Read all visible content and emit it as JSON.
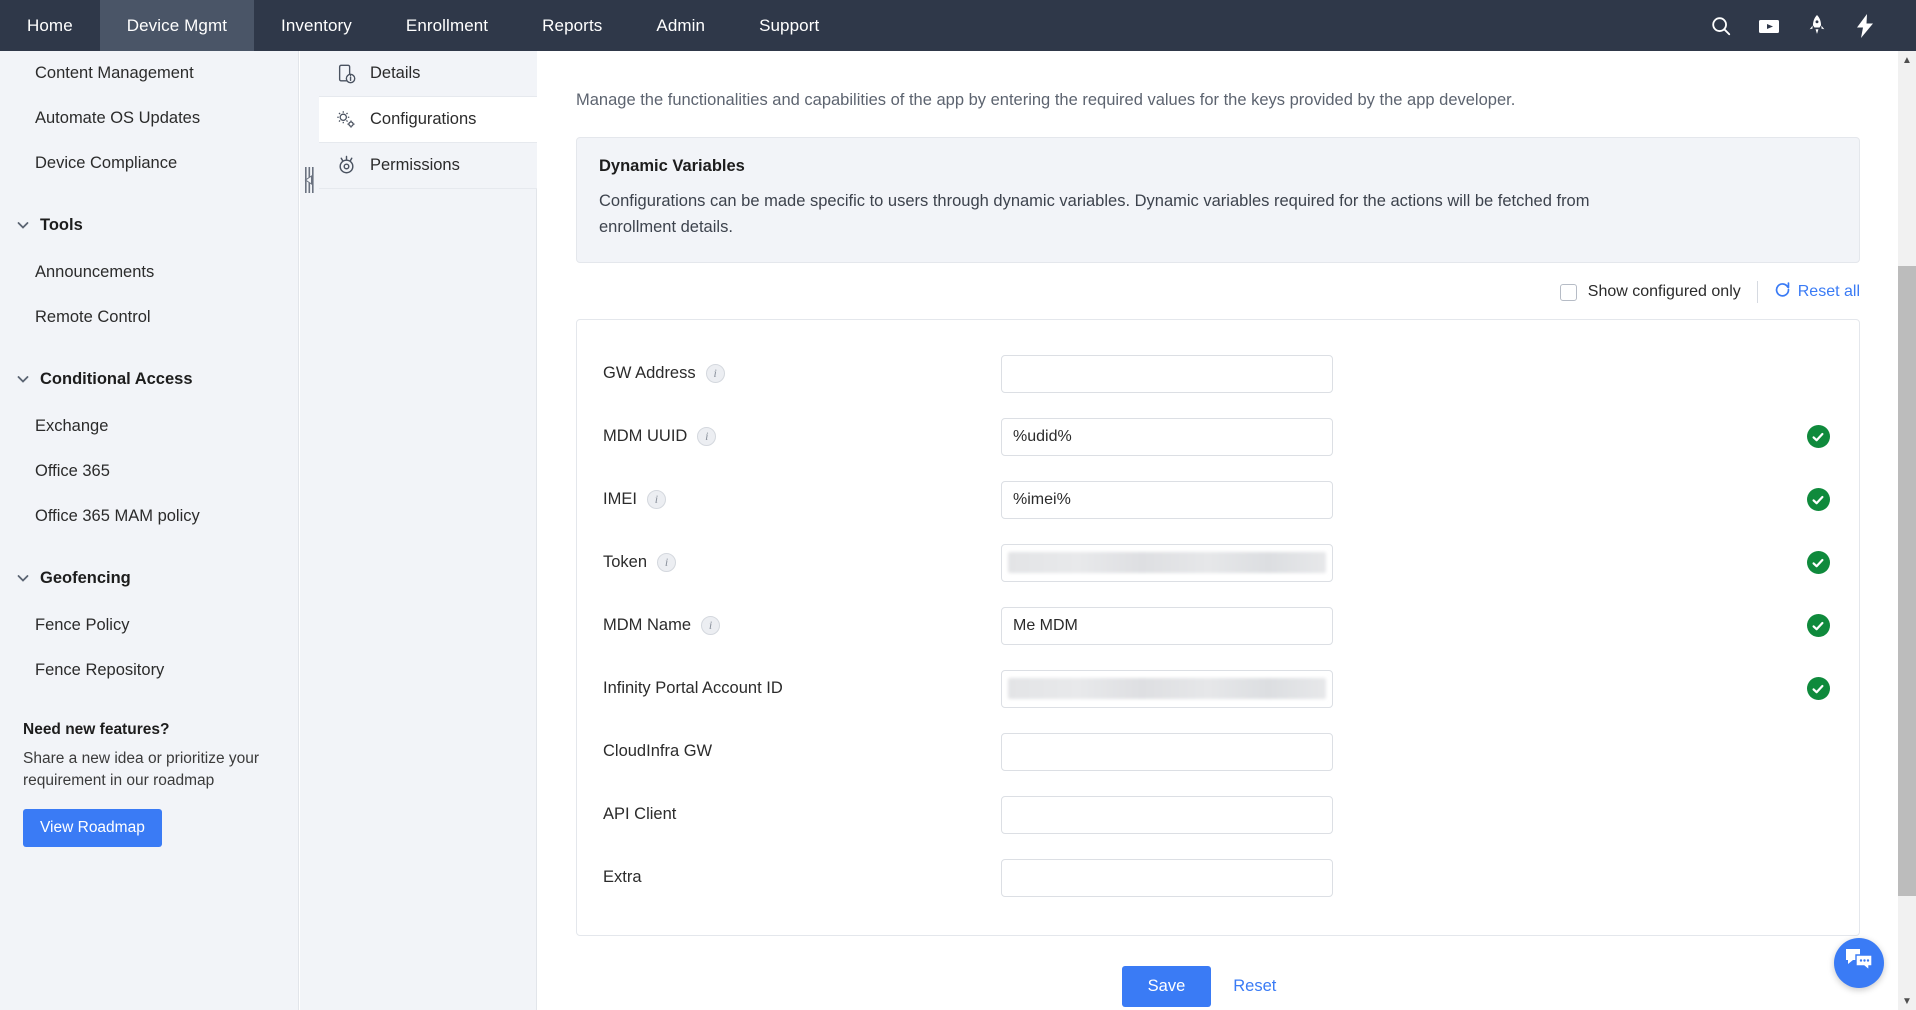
{
  "topnav": {
    "items": [
      {
        "label": "Home",
        "active": false
      },
      {
        "label": "Device Mgmt",
        "active": true
      },
      {
        "label": "Inventory",
        "active": false
      },
      {
        "label": "Enrollment",
        "active": false
      },
      {
        "label": "Reports",
        "active": false
      },
      {
        "label": "Admin",
        "active": false
      },
      {
        "label": "Support",
        "active": false
      }
    ],
    "icons": [
      "search-icon",
      "video-icon",
      "rocket-icon",
      "lightning-icon"
    ]
  },
  "sidebar": {
    "links_top": [
      {
        "label": "Content Management"
      },
      {
        "label": "Automate OS Updates"
      },
      {
        "label": "Device Compliance"
      }
    ],
    "groups": [
      {
        "label": "Tools",
        "items": [
          {
            "label": "Announcements"
          },
          {
            "label": "Remote Control"
          }
        ]
      },
      {
        "label": "Conditional Access",
        "items": [
          {
            "label": "Exchange"
          },
          {
            "label": "Office 365"
          },
          {
            "label": "Office 365 MAM policy"
          }
        ]
      },
      {
        "label": "Geofencing",
        "items": [
          {
            "label": "Fence Policy"
          },
          {
            "label": "Fence Repository"
          }
        ]
      }
    ],
    "promo": {
      "title": "Need new features?",
      "text": "Share a new idea or prioritize your requirement in our roadmap",
      "button": "View Roadmap"
    }
  },
  "subnav": {
    "items": [
      {
        "label": "Details",
        "icon": "device-info-icon",
        "active": false
      },
      {
        "label": "Configurations",
        "icon": "gears-icon",
        "active": true
      },
      {
        "label": "Permissions",
        "icon": "permissions-target-icon",
        "active": false
      }
    ]
  },
  "main": {
    "lead": "Manage the functionalities and capabilities of the app by entering the required values for the keys provided by the app developer.",
    "infobox": {
      "title": "Dynamic Variables",
      "body": "Configurations can be made specific to users through dynamic variables. Dynamic variables required for the actions will be fetched from enrollment details."
    },
    "toolbar": {
      "show_configured_only": "Show configured only",
      "show_configured_only_checked": false,
      "reset_all": "Reset all"
    },
    "fields": [
      {
        "label": "GW Address",
        "info": true,
        "value": "",
        "masked": false,
        "status": ""
      },
      {
        "label": "MDM UUID",
        "info": true,
        "value": "%udid%",
        "masked": false,
        "status": "ok"
      },
      {
        "label": "IMEI",
        "info": true,
        "value": "%imei%",
        "masked": false,
        "status": "ok"
      },
      {
        "label": "Token",
        "info": true,
        "value": "",
        "masked": true,
        "status": "ok"
      },
      {
        "label": "MDM Name",
        "info": true,
        "value": "Me MDM",
        "masked": false,
        "status": "ok"
      },
      {
        "label": "Infinity Portal Account ID",
        "info": false,
        "value": "",
        "masked": true,
        "status": "ok"
      },
      {
        "label": "CloudInfra GW",
        "info": false,
        "value": "",
        "masked": false,
        "status": ""
      },
      {
        "label": "API Client",
        "info": false,
        "value": "",
        "masked": false,
        "status": ""
      },
      {
        "label": "Extra",
        "info": false,
        "value": "",
        "masked": false,
        "status": ""
      }
    ],
    "actions": {
      "save": "Save",
      "reset": "Reset"
    }
  },
  "colors": {
    "nav_bg": "#2f3849",
    "nav_active": "#4a5567",
    "accent": "#3a7bf5",
    "success": "#0f8a3c",
    "panel_bg": "#f2f4f8"
  }
}
